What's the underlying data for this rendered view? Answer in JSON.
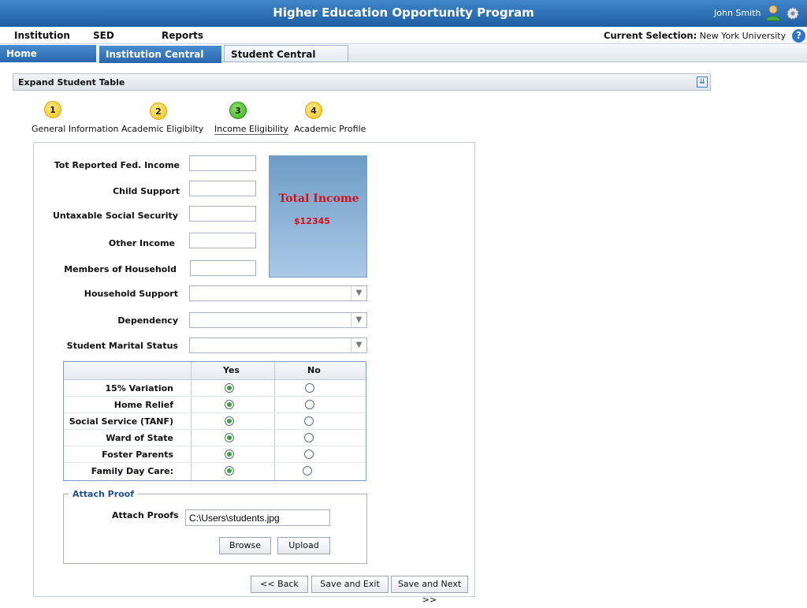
{
  "header": {
    "title": "Higher Education Opportunity Program",
    "user_name": "John  Smith",
    "user_icon": "user-icon",
    "settings_icon": "gear-icon"
  },
  "menu": {
    "items": [
      "Institution",
      "SED",
      "Reports"
    ],
    "current_selection_label": "Current Selection:",
    "current_selection_value": "New York University",
    "help_glyph": "?"
  },
  "tabs": [
    "Home",
    "Institution Central",
    "Student Central"
  ],
  "expand_bar": {
    "label": "Expand Student Table",
    "icon": "chevron-double-down-icon"
  },
  "steps": [
    {
      "num": "1",
      "label": "General Information",
      "status": "yellow"
    },
    {
      "num": "2",
      "label": "Academic Eligibilty",
      "status": "yellow"
    },
    {
      "num": "3",
      "label": "Income Eligibility",
      "status": "green",
      "active": true
    },
    {
      "num": "4",
      "label": "Academic Profile",
      "status": "yellow"
    }
  ],
  "form": {
    "fields": [
      "Tot Reported Fed. Income",
      "Child Support",
      "Untaxable Social Security",
      "Other Income",
      "Members of Household"
    ],
    "selects": [
      "Household Support",
      "Dependency",
      "Student Marital Status"
    ]
  },
  "total_income": {
    "title": "Total Income",
    "value": "$12345",
    "color": "#d4101a"
  },
  "yes_no_table": {
    "headers": [
      "Yes",
      "No"
    ],
    "rows": [
      {
        "label": "15% Variation",
        "selected": "Yes"
      },
      {
        "label": "Home Relief",
        "selected": "Yes"
      },
      {
        "label": "Social Service (TANF)",
        "selected": "Yes"
      },
      {
        "label": "Ward of State",
        "selected": "Yes"
      },
      {
        "label": "Foster Parents",
        "selected": "Yes"
      },
      {
        "label": "Family Day Care:",
        "selected": "Yes"
      }
    ]
  },
  "attach": {
    "legend": "Attach Proof",
    "label": "Attach Proofs",
    "value": "C:\\Users\\students.jpg",
    "browse": "Browse",
    "upload": "Upload"
  },
  "nav_buttons": {
    "back": "<< Back",
    "save_exit": "Save and Exit",
    "save_next": "Save and Next >>"
  }
}
